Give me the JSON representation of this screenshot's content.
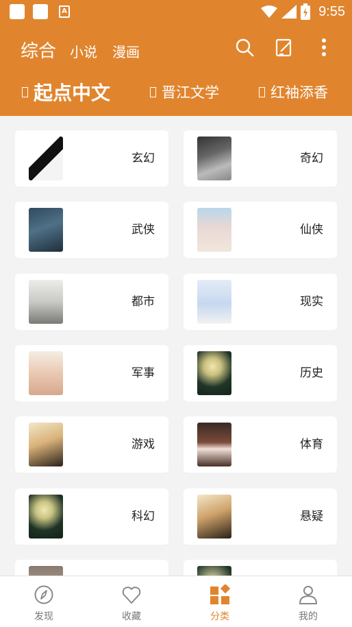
{
  "status_bar": {
    "time": "9:55",
    "notification_letter": "A"
  },
  "header": {
    "tabs": [
      {
        "label": "综合",
        "active": true
      },
      {
        "label": "小说",
        "active": false
      },
      {
        "label": "漫画",
        "active": false
      }
    ],
    "actions": [
      "search-icon",
      "edit-icon",
      "more-icon"
    ],
    "sources": [
      {
        "label": "起点中文",
        "active": true
      },
      {
        "label": "晋江文学",
        "active": false
      },
      {
        "label": "红袖添香",
        "active": false
      }
    ]
  },
  "categories": [
    {
      "label": "玄幻"
    },
    {
      "label": "奇幻"
    },
    {
      "label": "武侠"
    },
    {
      "label": "仙侠"
    },
    {
      "label": "都市"
    },
    {
      "label": "现实"
    },
    {
      "label": "军事"
    },
    {
      "label": "历史"
    },
    {
      "label": "游戏"
    },
    {
      "label": "体育"
    },
    {
      "label": "科幻"
    },
    {
      "label": "悬疑"
    }
  ],
  "bottom_nav": [
    {
      "label": "发现",
      "icon": "compass-icon",
      "active": false
    },
    {
      "label": "收藏",
      "icon": "heart-icon",
      "active": false
    },
    {
      "label": "分类",
      "icon": "category-icon",
      "active": true
    },
    {
      "label": "我的",
      "icon": "user-icon",
      "active": false
    }
  ],
  "colors": {
    "accent": "#e0852e",
    "background": "#f3f3f3",
    "card": "#ffffff"
  }
}
